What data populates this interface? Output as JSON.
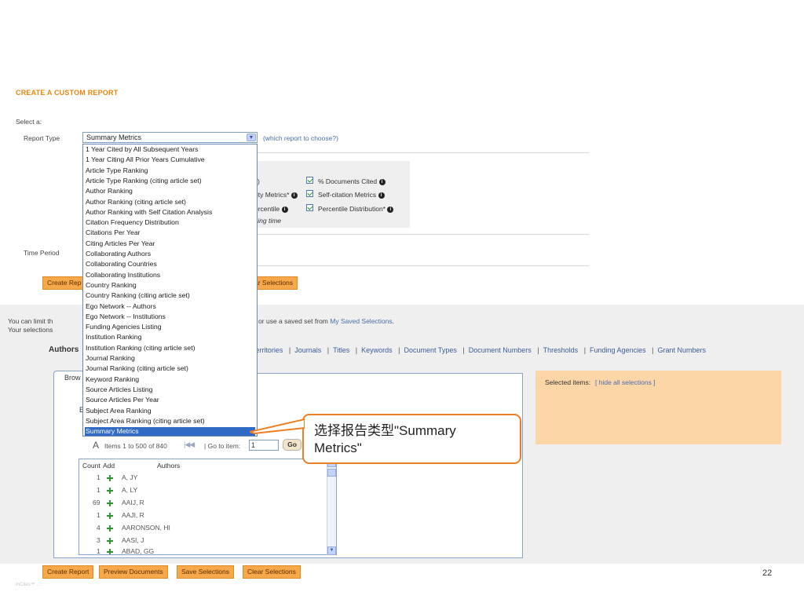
{
  "title": "CREATE A CUSTOM REPORT",
  "select_a": "Select a:",
  "report_type": {
    "label": "Report Type",
    "selected": "Summary Metrics",
    "help_link": "(which report to choose?)"
  },
  "dropdown_options": [
    "1 Year Cited by All Subsequent Years",
    "1 Year Citing All Prior Years Cumulative",
    "Article Type Ranking",
    "Article Type Ranking (citing article set)",
    "Author Ranking",
    "Author Ranking (citing article set)",
    "Author Ranking with Self Citation Analysis",
    "Citation Frequency Distribution",
    "Citations Per Year",
    "Citing Articles Per Year",
    "Collaborating Authors",
    "Collaborating Countries",
    "Collaborating Institutions",
    "Country Ranking",
    "Country Ranking (citing article set)",
    "Ego Network -- Authors",
    "Ego Network -- Institutions",
    "Funding Agencies Listing",
    "Institution Ranking",
    "Institution Ranking (citing article set)",
    "Journal Ranking",
    "Journal Ranking (citing article set)",
    "Keyword Ranking",
    "Source Articles Listing",
    "Source Articles Per Year",
    "Subject Area Ranking",
    "Subject Area Ranking (citing article set)",
    "Summary Metrics"
  ],
  "metrics": {
    "col1": [
      "rity Metrics*",
      "ercentile"
    ],
    "col2": [
      "% Documents Cited",
      "Self-citation Metrics",
      "Percentile Distribution*"
    ],
    "note": "sing time"
  },
  "time_period_label": "Time Period",
  "buttons_top": {
    "create_report_partial": "Create Rep",
    "clear_selections_partial": "ar Selections"
  },
  "limit_text_left": "You can limit th",
  "limit_text_left2": "Your selections",
  "limit_text_right": "ms, or use a saved set from",
  "my_saved_selections": "My Saved Selections",
  "authors_tab_partial": "Authors",
  "tabs": [
    "erritories",
    "Journals",
    "Titles",
    "Keywords",
    "Document Types",
    "Document Numbers",
    "Thresholds",
    "Funding Agencies",
    "Grant Numbers"
  ],
  "browse_tab_partial": "Brow",
  "stray_char": "E",
  "selected_items": {
    "label": "Selected items:",
    "link": "[ hide all selections ]"
  },
  "pager": {
    "letter": "A",
    "items_text": "Items 1 to 500 of 840",
    "go_to_label": "Go to item:",
    "go_to_value": "1",
    "go_button": "Go"
  },
  "author_table": {
    "headers": [
      "Count",
      "Add",
      "Authors"
    ],
    "rows": [
      {
        "count": "1",
        "name": "A, JY"
      },
      {
        "count": "1",
        "name": "A, LY"
      },
      {
        "count": "69",
        "name": "AAIJ, R"
      },
      {
        "count": "1",
        "name": "AAJI, R"
      },
      {
        "count": "4",
        "name": "AARONSON, HI"
      },
      {
        "count": "3",
        "name": "AASI, J"
      },
      {
        "count": "1",
        "name": "ABAD, GG"
      }
    ]
  },
  "callout": {
    "line1": "选择报告类型\"Summary",
    "line2": "Metrics\""
  },
  "buttons_bottom": [
    "Create Report",
    "Preview Documents",
    "Save Selections",
    "Clear Selections"
  ],
  "page_number": "22",
  "footer_faded": "InCites™ …",
  "colors": {
    "accent_orange": "#e8850f",
    "button_orange": "#f7a84a",
    "selected_panel": "#fdd6a8",
    "highlight_blue": "#316ac5",
    "callout_border": "#ef7d22"
  }
}
